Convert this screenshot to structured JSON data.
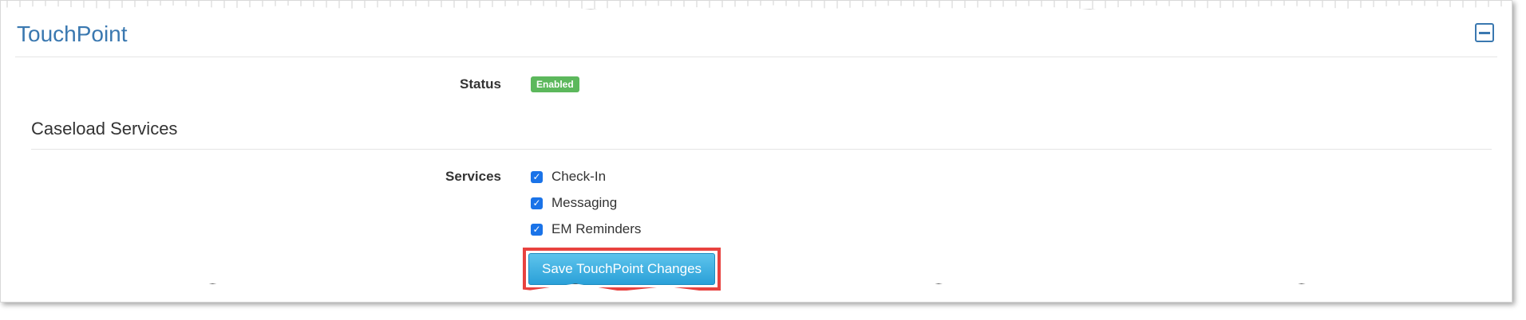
{
  "panel": {
    "title": "TouchPoint",
    "collapse_icon": "minus-square-icon"
  },
  "status": {
    "label": "Status",
    "badge": "Enabled",
    "badge_color": "#5cb85c"
  },
  "caseload_services": {
    "heading": "Caseload Services",
    "services_label": "Services",
    "items": [
      {
        "label": "Check-In",
        "checked": true
      },
      {
        "label": "Messaging",
        "checked": true
      },
      {
        "label": "EM Reminders",
        "checked": true
      }
    ]
  },
  "save_button": {
    "label": "Save TouchPoint Changes",
    "highlight_color": "#e8423f"
  },
  "colors": {
    "accent": "#3a78b0",
    "button": "#2aa0d8"
  }
}
